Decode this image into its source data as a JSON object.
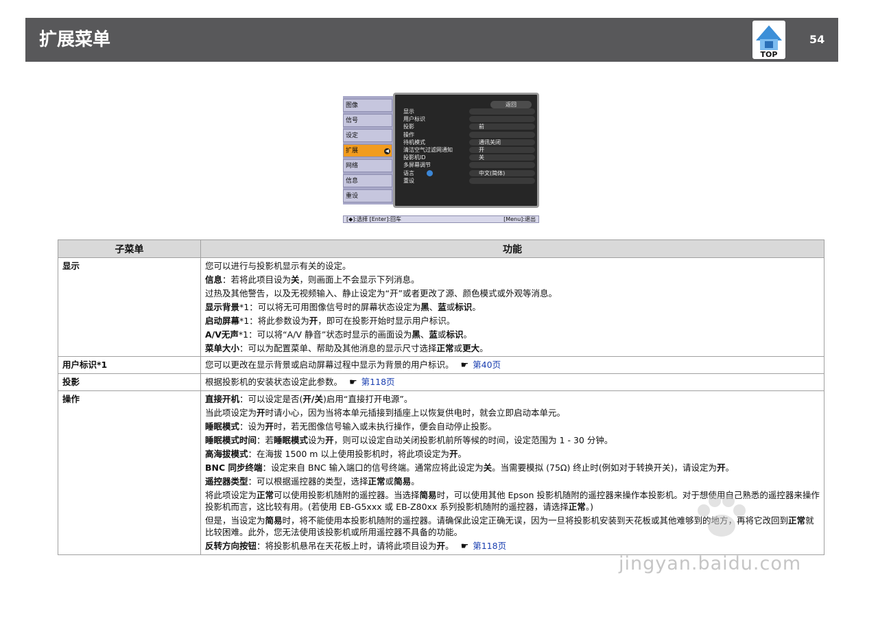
{
  "header": {
    "title": "扩展菜单",
    "top_icon_label": "TOP",
    "page_number": "54"
  },
  "menu_screen": {
    "left_items": [
      "图像",
      "信号",
      "设定",
      "扩展",
      "网络",
      "信息",
      "重设"
    ],
    "active_item": "扩展",
    "back_button": "返回",
    "rows": [
      {
        "label": "显示",
        "value": ""
      },
      {
        "label": "用户标识",
        "value": ""
      },
      {
        "label": "投影",
        "value": "前"
      },
      {
        "label": "操作",
        "value": ""
      },
      {
        "label": "待机模式",
        "value": "通讯关闭"
      },
      {
        "label": "清洁空气过滤网通知",
        "value": "开"
      },
      {
        "label": "投影机ID",
        "value": "关"
      },
      {
        "label": "多屏幕调节",
        "value": ""
      },
      {
        "label": "语言",
        "value": "中文(简体)"
      },
      {
        "label": "重设",
        "value": ""
      }
    ],
    "footer_left": "[◆]:选择 [Enter]:回车",
    "footer_right": "[Menu]:退出"
  },
  "table": {
    "headers": [
      "子菜单",
      "功能"
    ],
    "rows": [
      {
        "name": "显示",
        "paragraphs": [
          {
            "parts": [
              {
                "t": "您可以进行与投影机显示有关的设定。",
                "b": false
              }
            ]
          },
          {
            "parts": [
              {
                "t": "信息",
                "b": true
              },
              {
                "t": "：若将此项目设为",
                "b": false
              },
              {
                "t": "关",
                "b": true
              },
              {
                "t": "，则画面上不会显示下列消息。",
                "b": false
              }
            ]
          },
          {
            "parts": [
              {
                "t": "过热及其他警告，以及无视频输入、静止设定为“开”或者更改了源、颜色模式或外观等消息。",
                "b": false
              }
            ]
          },
          {
            "parts": [
              {
                "t": "显示背景",
                "b": true
              },
              {
                "t": "*1：可以将无可用图像信号时的屏幕状态设定为",
                "b": false
              },
              {
                "t": "黑",
                "b": true
              },
              {
                "t": "、",
                "b": false
              },
              {
                "t": "蓝",
                "b": true
              },
              {
                "t": "或",
                "b": false
              },
              {
                "t": "标识",
                "b": true
              },
              {
                "t": "。",
                "b": false
              }
            ]
          },
          {
            "parts": [
              {
                "t": "启动屏幕",
                "b": true
              },
              {
                "t": "*1：将此参数设为",
                "b": false
              },
              {
                "t": "开",
                "b": true
              },
              {
                "t": "，即可在投影开始时显示用户标识。",
                "b": false
              }
            ]
          },
          {
            "parts": [
              {
                "t": "A/V无声",
                "b": true
              },
              {
                "t": "*1：可以将“A/V 静音”状态时显示的画面设为",
                "b": false
              },
              {
                "t": "黑",
                "b": true
              },
              {
                "t": "、",
                "b": false
              },
              {
                "t": "蓝",
                "b": true
              },
              {
                "t": "或",
                "b": false
              },
              {
                "t": "标识",
                "b": true
              },
              {
                "t": "。",
                "b": false
              }
            ]
          },
          {
            "parts": [
              {
                "t": "菜单大小",
                "b": true
              },
              {
                "t": "：可以为配置菜单、帮助及其他消息的显示尺寸选择",
                "b": false
              },
              {
                "t": "正常",
                "b": true
              },
              {
                "t": "或",
                "b": false
              },
              {
                "t": "更大",
                "b": true
              },
              {
                "t": "。",
                "b": false
              }
            ]
          }
        ]
      },
      {
        "name": "用户标识*1",
        "paragraphs": [
          {
            "parts": [
              {
                "t": "您可以更改在显示背景或启动屏幕过程中显示为背景的用户标识。",
                "b": false
              }
            ],
            "ref": "第40页"
          }
        ]
      },
      {
        "name": "投影",
        "paragraphs": [
          {
            "parts": [
              {
                "t": "根据投影机的安装状态设定此参数。",
                "b": false
              }
            ],
            "ref": "第118页"
          }
        ]
      },
      {
        "name": "操作",
        "paragraphs": [
          {
            "parts": [
              {
                "t": "直接开机",
                "b": true
              },
              {
                "t": "：可以设定是否(",
                "b": false
              },
              {
                "t": "开/关",
                "b": true
              },
              {
                "t": ")启用“直接打开电源”。",
                "b": false
              }
            ]
          },
          {
            "parts": [
              {
                "t": "当此项设定为",
                "b": false
              },
              {
                "t": "开",
                "b": true
              },
              {
                "t": "时请小心，因为当将本单元插接到插座上以恢复供电时，就会立即启动本单元。",
                "b": false
              }
            ]
          },
          {
            "parts": [
              {
                "t": "睡眠模式",
                "b": true
              },
              {
                "t": "：设为",
                "b": false
              },
              {
                "t": "开",
                "b": true
              },
              {
                "t": "时，若无图像信号输入或未执行操作，便会自动停止投影。",
                "b": false
              }
            ]
          },
          {
            "parts": [
              {
                "t": "睡眠模式时间",
                "b": true
              },
              {
                "t": "：若",
                "b": false
              },
              {
                "t": "睡眠模式",
                "b": true
              },
              {
                "t": "设为",
                "b": false
              },
              {
                "t": "开",
                "b": true
              },
              {
                "t": "，则可以设定自动关闭投影机前所等候的时间，设定范围为 1 - 30 分钟。",
                "b": false
              }
            ]
          },
          {
            "parts": [
              {
                "t": "高海拔模式",
                "b": true
              },
              {
                "t": "：在海拔 1500 m 以上使用投影机时，将此项设定为",
                "b": false
              },
              {
                "t": "开",
                "b": true
              },
              {
                "t": "。",
                "b": false
              }
            ]
          },
          {
            "parts": [
              {
                "t": "BNC 同步终端",
                "b": true
              },
              {
                "t": "：设定来自 BNC 输入端口的信号终端。通常应将此设定为",
                "b": false
              },
              {
                "t": "关",
                "b": true
              },
              {
                "t": "。当需要模拟 (75Ω) 终止时(例如对于转换开关)，请设定为",
                "b": false
              },
              {
                "t": "开",
                "b": true
              },
              {
                "t": "。",
                "b": false
              }
            ]
          },
          {
            "parts": [
              {
                "t": "遥控器类型",
                "b": true
              },
              {
                "t": "：可以根据遥控器的类型，选择",
                "b": false
              },
              {
                "t": "正常",
                "b": true
              },
              {
                "t": "或",
                "b": false
              },
              {
                "t": "简易",
                "b": true
              },
              {
                "t": "。",
                "b": false
              }
            ]
          },
          {
            "parts": [
              {
                "t": "将此项设定为",
                "b": false
              },
              {
                "t": "正常",
                "b": true
              },
              {
                "t": "可以使用投影机随附的遥控器。当选择",
                "b": false
              },
              {
                "t": "简易",
                "b": true
              },
              {
                "t": "时，可以使用其他 Epson 投影机随附的遥控器来操作本投影机。对于想使用自己熟悉的遥控器来操作投影机而言，这比较有用。(若使用 EB-G5xxx 或 EB-Z80xx 系列投影机随附的遥控器，请选择",
                "b": false
              },
              {
                "t": "正常",
                "b": true
              },
              {
                "t": "。)",
                "b": false
              }
            ]
          },
          {
            "parts": [
              {
                "t": "但是，当设定为",
                "b": false
              },
              {
                "t": "简易",
                "b": true
              },
              {
                "t": "时，将不能使用本投影机随附的遥控器。请确保此设定正确无误，因为一旦将投影机安装到天花板或其他难够到的地方，再将它改回到",
                "b": false
              },
              {
                "t": "正常",
                "b": true
              },
              {
                "t": "就比较困难。此外，您无法使用该投影机或所用遥控器不具备的功能。",
                "b": false
              }
            ]
          },
          {
            "parts": [
              {
                "t": "反转方向按钮",
                "b": true
              },
              {
                "t": "：将投影机悬吊在天花板上时，请将此项目设为",
                "b": false
              },
              {
                "t": "开",
                "b": true
              },
              {
                "t": "。",
                "b": false
              }
            ],
            "ref": "第118页"
          }
        ]
      }
    ]
  },
  "watermark": "jingyan.baidu.com",
  "colors": {
    "header_bg": "#58585a",
    "menu_active": "#f29c1f",
    "link": "#1a3fb0",
    "table_header_bg": "#d9d9d9"
  },
  "icons": {
    "top": "home-top-icon",
    "reference": "pointing-hand-icon",
    "language": "globe-icon"
  }
}
